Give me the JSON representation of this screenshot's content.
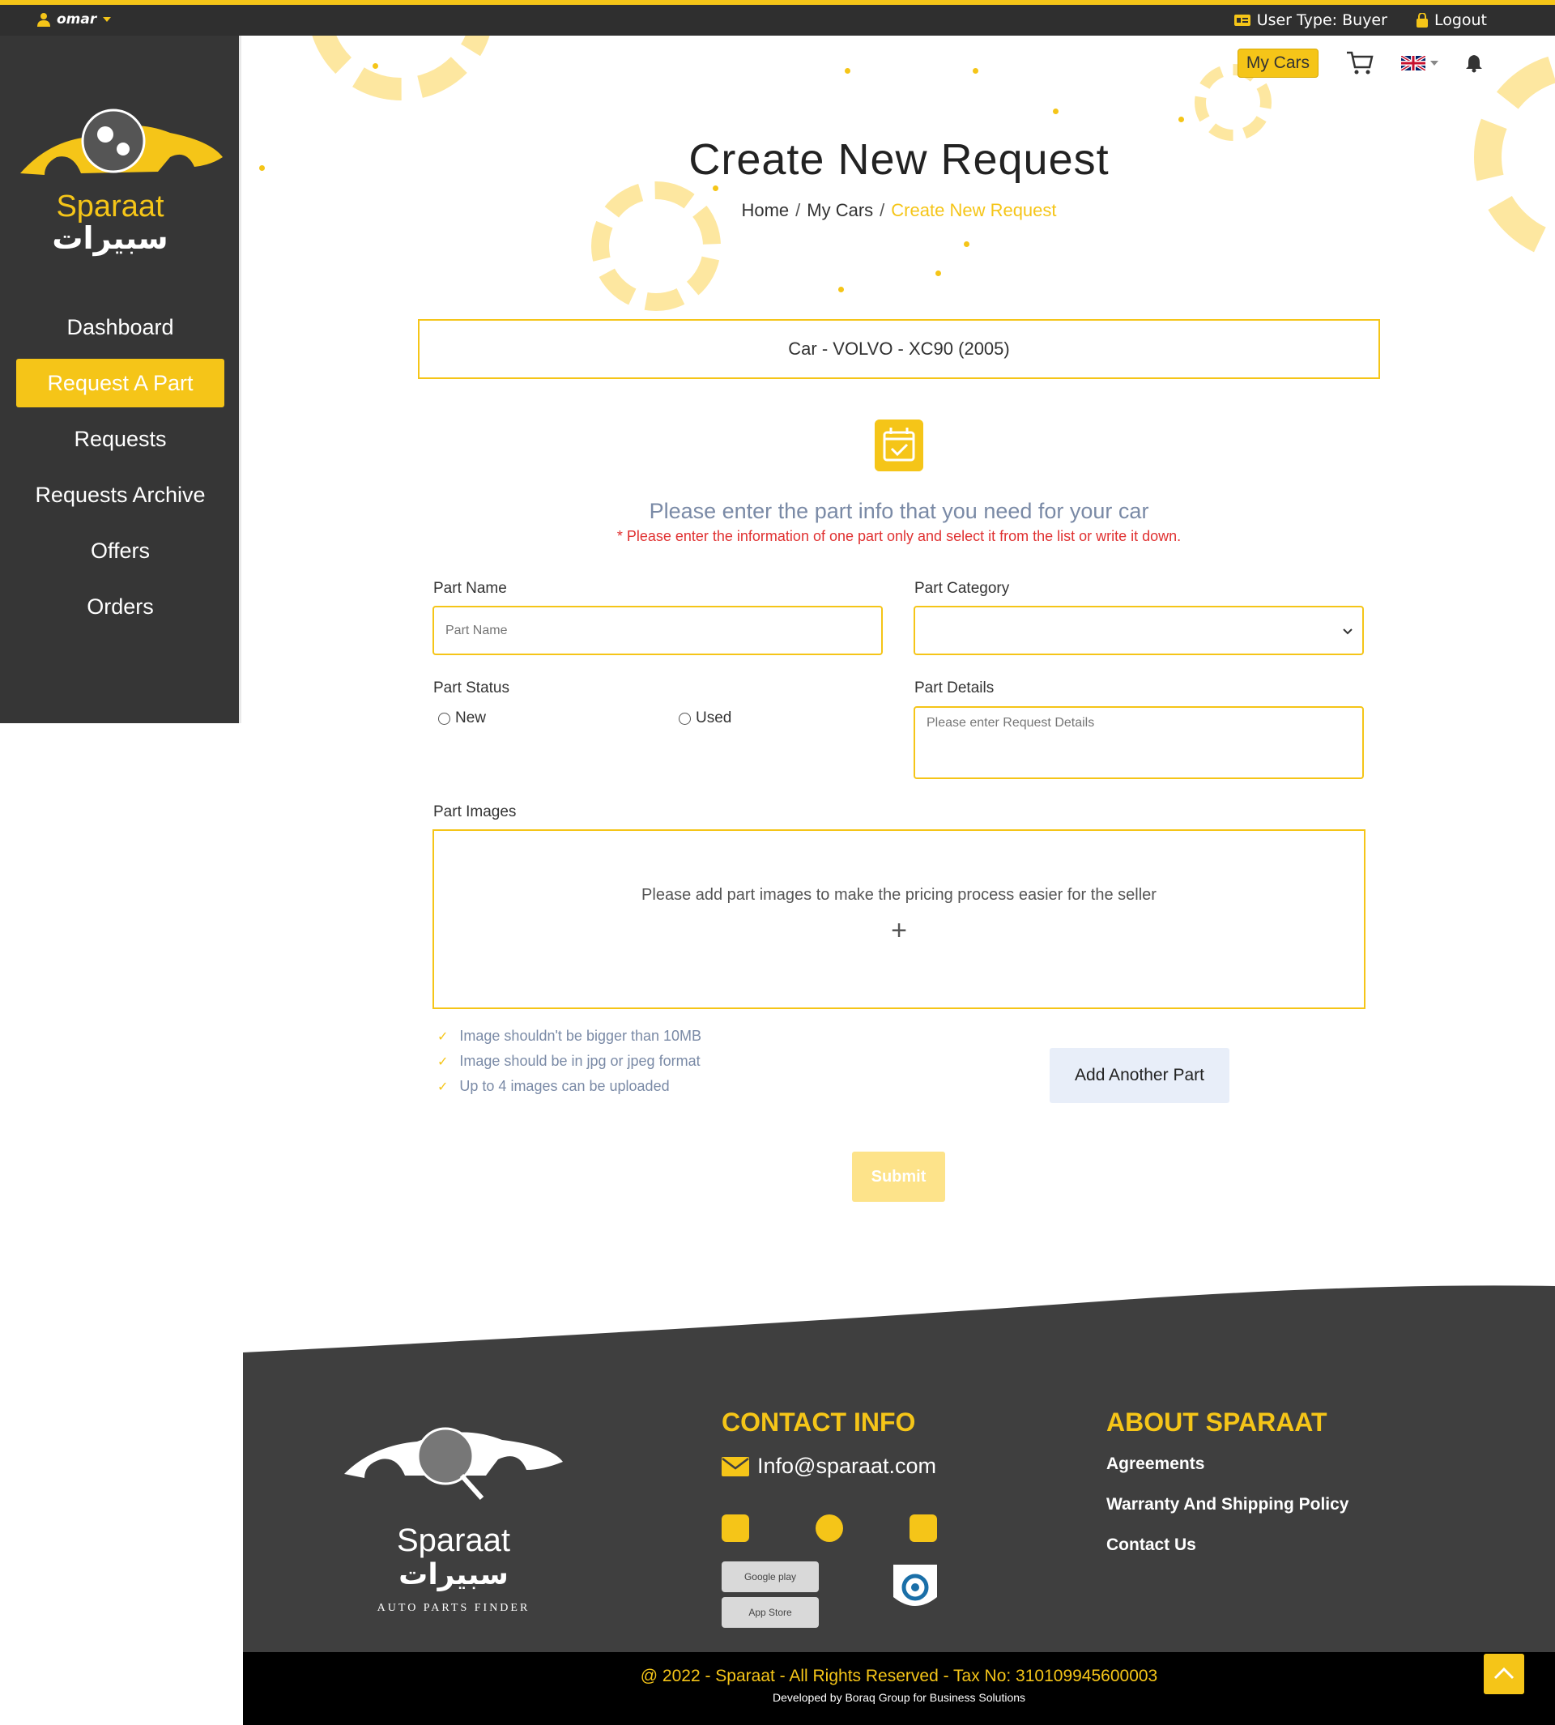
{
  "topbar": {
    "user": "omar",
    "user_type": "User Type: Buyer",
    "logout": "Logout"
  },
  "sidebar": {
    "brand_en": "Sparaat",
    "brand_ar": "سبيرات",
    "items": [
      {
        "label": "Dashboard"
      },
      {
        "label": "Request A Part"
      },
      {
        "label": "Requests"
      },
      {
        "label": "Requests Archive"
      },
      {
        "label": "Offers"
      },
      {
        "label": "Orders"
      }
    ]
  },
  "header": {
    "my_cars_button": "My Cars",
    "title": "Create New Request",
    "breadcrumb": [
      "Home",
      "My Cars",
      "Create New Request"
    ]
  },
  "car": "Car - VOLVO - XC90 (2005)",
  "form": {
    "info_main": "Please enter the part info that you need for your car",
    "info_note": "* Please enter the information of one part only and select it from the list or write it down.",
    "part_name_label": "Part Name",
    "part_name_placeholder": "Part Name",
    "part_category_label": "Part Category",
    "part_category_value": "",
    "part_status_label": "Part Status",
    "status_new": "New",
    "status_used": "Used",
    "part_details_label": "Part Details",
    "part_details_placeholder": "Please enter Request Details",
    "part_images_label": "Part Images",
    "images_hint": "Please add part images to make the pricing process easier for the seller",
    "images_plus": "+",
    "rules": [
      "Image shouldn't be bigger than 10MB",
      "Image should be in jpg or jpeg format",
      "Up to 4 images can be uploaded"
    ],
    "add_another": "Add Another Part",
    "submit": "Submit"
  },
  "footer": {
    "brand_en": "Sparaat",
    "brand_ar": "سبيرات",
    "tagline": "AUTO PARTS FINDER",
    "contact_title": "CONTACT INFO",
    "email": "Info@sparaat.com",
    "about_title": "ABOUT SPARAAT",
    "links": [
      "Agreements",
      "Warranty And Shipping Policy",
      "Contact Us"
    ],
    "google_play": "Google play",
    "app_store": "App Store",
    "copyright": "@ 2022 - Sparaat - All Rights Reserved - Tax No: 310109945600003",
    "developed": "Developed by Boraq Group for Business Solutions"
  },
  "colors": {
    "accent": "#f5c518",
    "dark": "#363636"
  }
}
